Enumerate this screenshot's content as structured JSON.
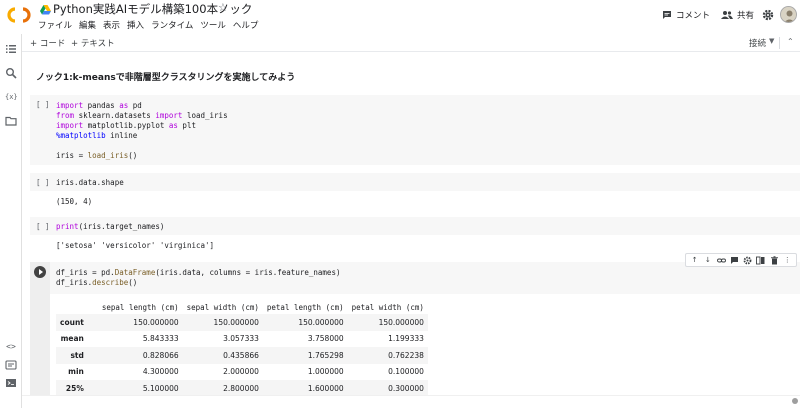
{
  "header": {
    "title": "Python実践AIモデル構築100本ノック",
    "menu": [
      "ファイル",
      "編集",
      "表示",
      "挿入",
      "ランタイム",
      "ツール",
      "ヘルプ"
    ],
    "comment_label": "コメント",
    "share_label": "共有"
  },
  "toolbar": {
    "add_code": "+ コード",
    "add_text": "+ テキスト",
    "connect": "接続"
  },
  "notebook": {
    "heading": "ノック1:k-meansで非階層型クラスタリングを実施してみよう",
    "cells": [
      {
        "indicator": "[ ]",
        "code": [
          "import pandas as pd",
          "from sklearn.datasets import load_iris",
          "import matplotlib.pyplot as plt",
          "%matplotlib inline",
          "",
          "iris = load_iris()"
        ]
      },
      {
        "indicator": "[ ]",
        "code": [
          "iris.data.shape"
        ],
        "output": "(150, 4)"
      },
      {
        "indicator": "[ ]",
        "code": [
          "print(iris.target_names)"
        ],
        "output": "['setosa' 'versicolor' 'virginica']"
      },
      {
        "code": [
          "df_iris = pd.DataFrame(iris.data, columns = iris.feature_names)",
          "df_iris.describe()"
        ]
      }
    ],
    "table": {
      "columns": [
        "sepal length (cm)",
        "sepal width (cm)",
        "petal length (cm)",
        "petal width (cm)"
      ],
      "rows": [
        {
          "label": "count",
          "values": [
            "150.000000",
            "150.000000",
            "150.000000",
            "150.000000"
          ]
        },
        {
          "label": "mean",
          "values": [
            "5.843333",
            "3.057333",
            "3.758000",
            "1.199333"
          ]
        },
        {
          "label": "std",
          "values": [
            "0.828066",
            "0.435866",
            "1.765298",
            "0.762238"
          ]
        },
        {
          "label": "min",
          "values": [
            "4.300000",
            "2.000000",
            "1.000000",
            "0.100000"
          ]
        },
        {
          "label": "25%",
          "values": [
            "5.100000",
            "2.800000",
            "1.600000",
            "0.300000"
          ]
        }
      ]
    }
  }
}
